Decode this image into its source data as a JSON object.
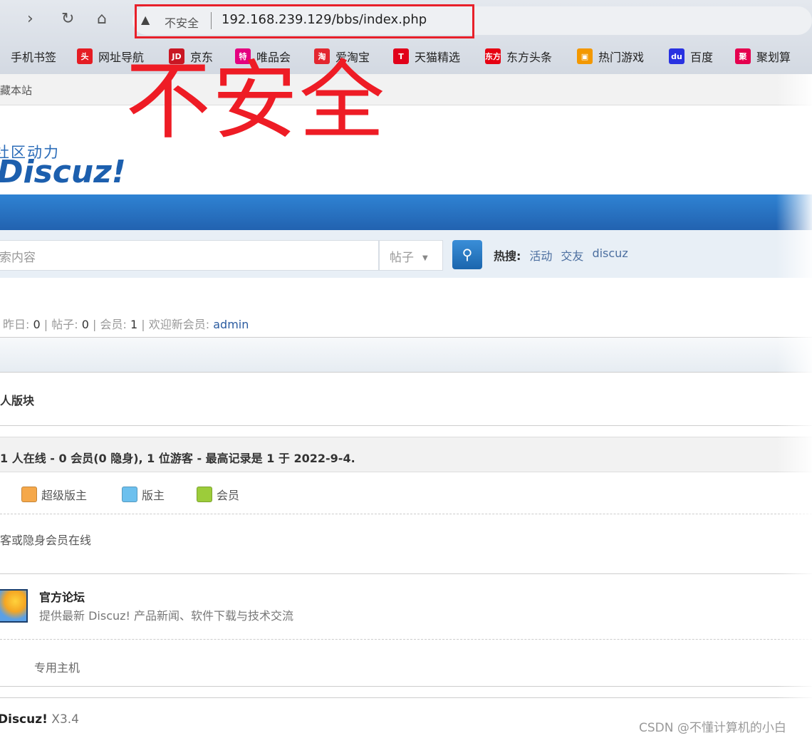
{
  "browser": {
    "url": "192.168.239.129/bbs/index.php",
    "security_label": "不安全",
    "bookmarks": [
      {
        "label": "手机书签",
        "icon": "none"
      },
      {
        "label": "网址导航",
        "icon": "hao-icon",
        "color": "#e51c23",
        "glyph": "头"
      },
      {
        "label": "京东",
        "icon": "jd-icon",
        "color": "#c91623",
        "glyph": "JD"
      },
      {
        "label": "唯品会",
        "icon": "vip-icon",
        "color": "#e4007f",
        "glyph": "特"
      },
      {
        "label": "爱淘宝",
        "icon": "taobao-icon",
        "color": "#e3262f",
        "glyph": "淘"
      },
      {
        "label": "天猫精选",
        "icon": "tmall-icon",
        "color": "#e1001a",
        "glyph": "T"
      },
      {
        "label": "东方头条",
        "icon": "dftt-icon",
        "color": "#e60012",
        "glyph": "东方"
      },
      {
        "label": "热门游戏",
        "icon": "game-icon",
        "color": "#f39800",
        "glyph": "▣"
      },
      {
        "label": "百度",
        "icon": "baidu-icon",
        "color": "#2932e1",
        "glyph": "du"
      },
      {
        "label": "聚划算",
        "icon": "juhuasuan-icon",
        "color": "#e5004f",
        "glyph": "聚"
      }
    ]
  },
  "annotation": {
    "big_text": "不安全"
  },
  "topbar": {
    "favorite": "藏本站"
  },
  "logo": {
    "line1": "社区动力",
    "line2": "Discuz!"
  },
  "search": {
    "placeholder": "索内容",
    "type": "帖子",
    "hot_label": "热搜:",
    "hot": [
      "活动",
      "交友",
      "discuz"
    ]
  },
  "stats": {
    "yesterday_label": "昨日:",
    "yesterday": "0",
    "posts_label": "帖子:",
    "posts": "0",
    "members_label": "会员:",
    "members": "1",
    "newest_label": "欢迎新会员:",
    "newest": "admin"
  },
  "category": "人版块",
  "online": {
    "summary": "1 人在线 - 0 会员(0 隐身), 1 位游客 - 最高记录是 1 于 2022-9-4.",
    "legend": [
      "超级版主",
      "版主",
      "会员"
    ],
    "none": "客或隐身会员在线"
  },
  "forum": {
    "title": "官方论坛",
    "desc": "提供最新 Discuz! 产品新闻、软件下载与技术交流",
    "link": "专用主机"
  },
  "footer": {
    "brand": "Discuz!",
    "version": "X3.4"
  },
  "watermark": "CSDN @不懂计算机的小白"
}
